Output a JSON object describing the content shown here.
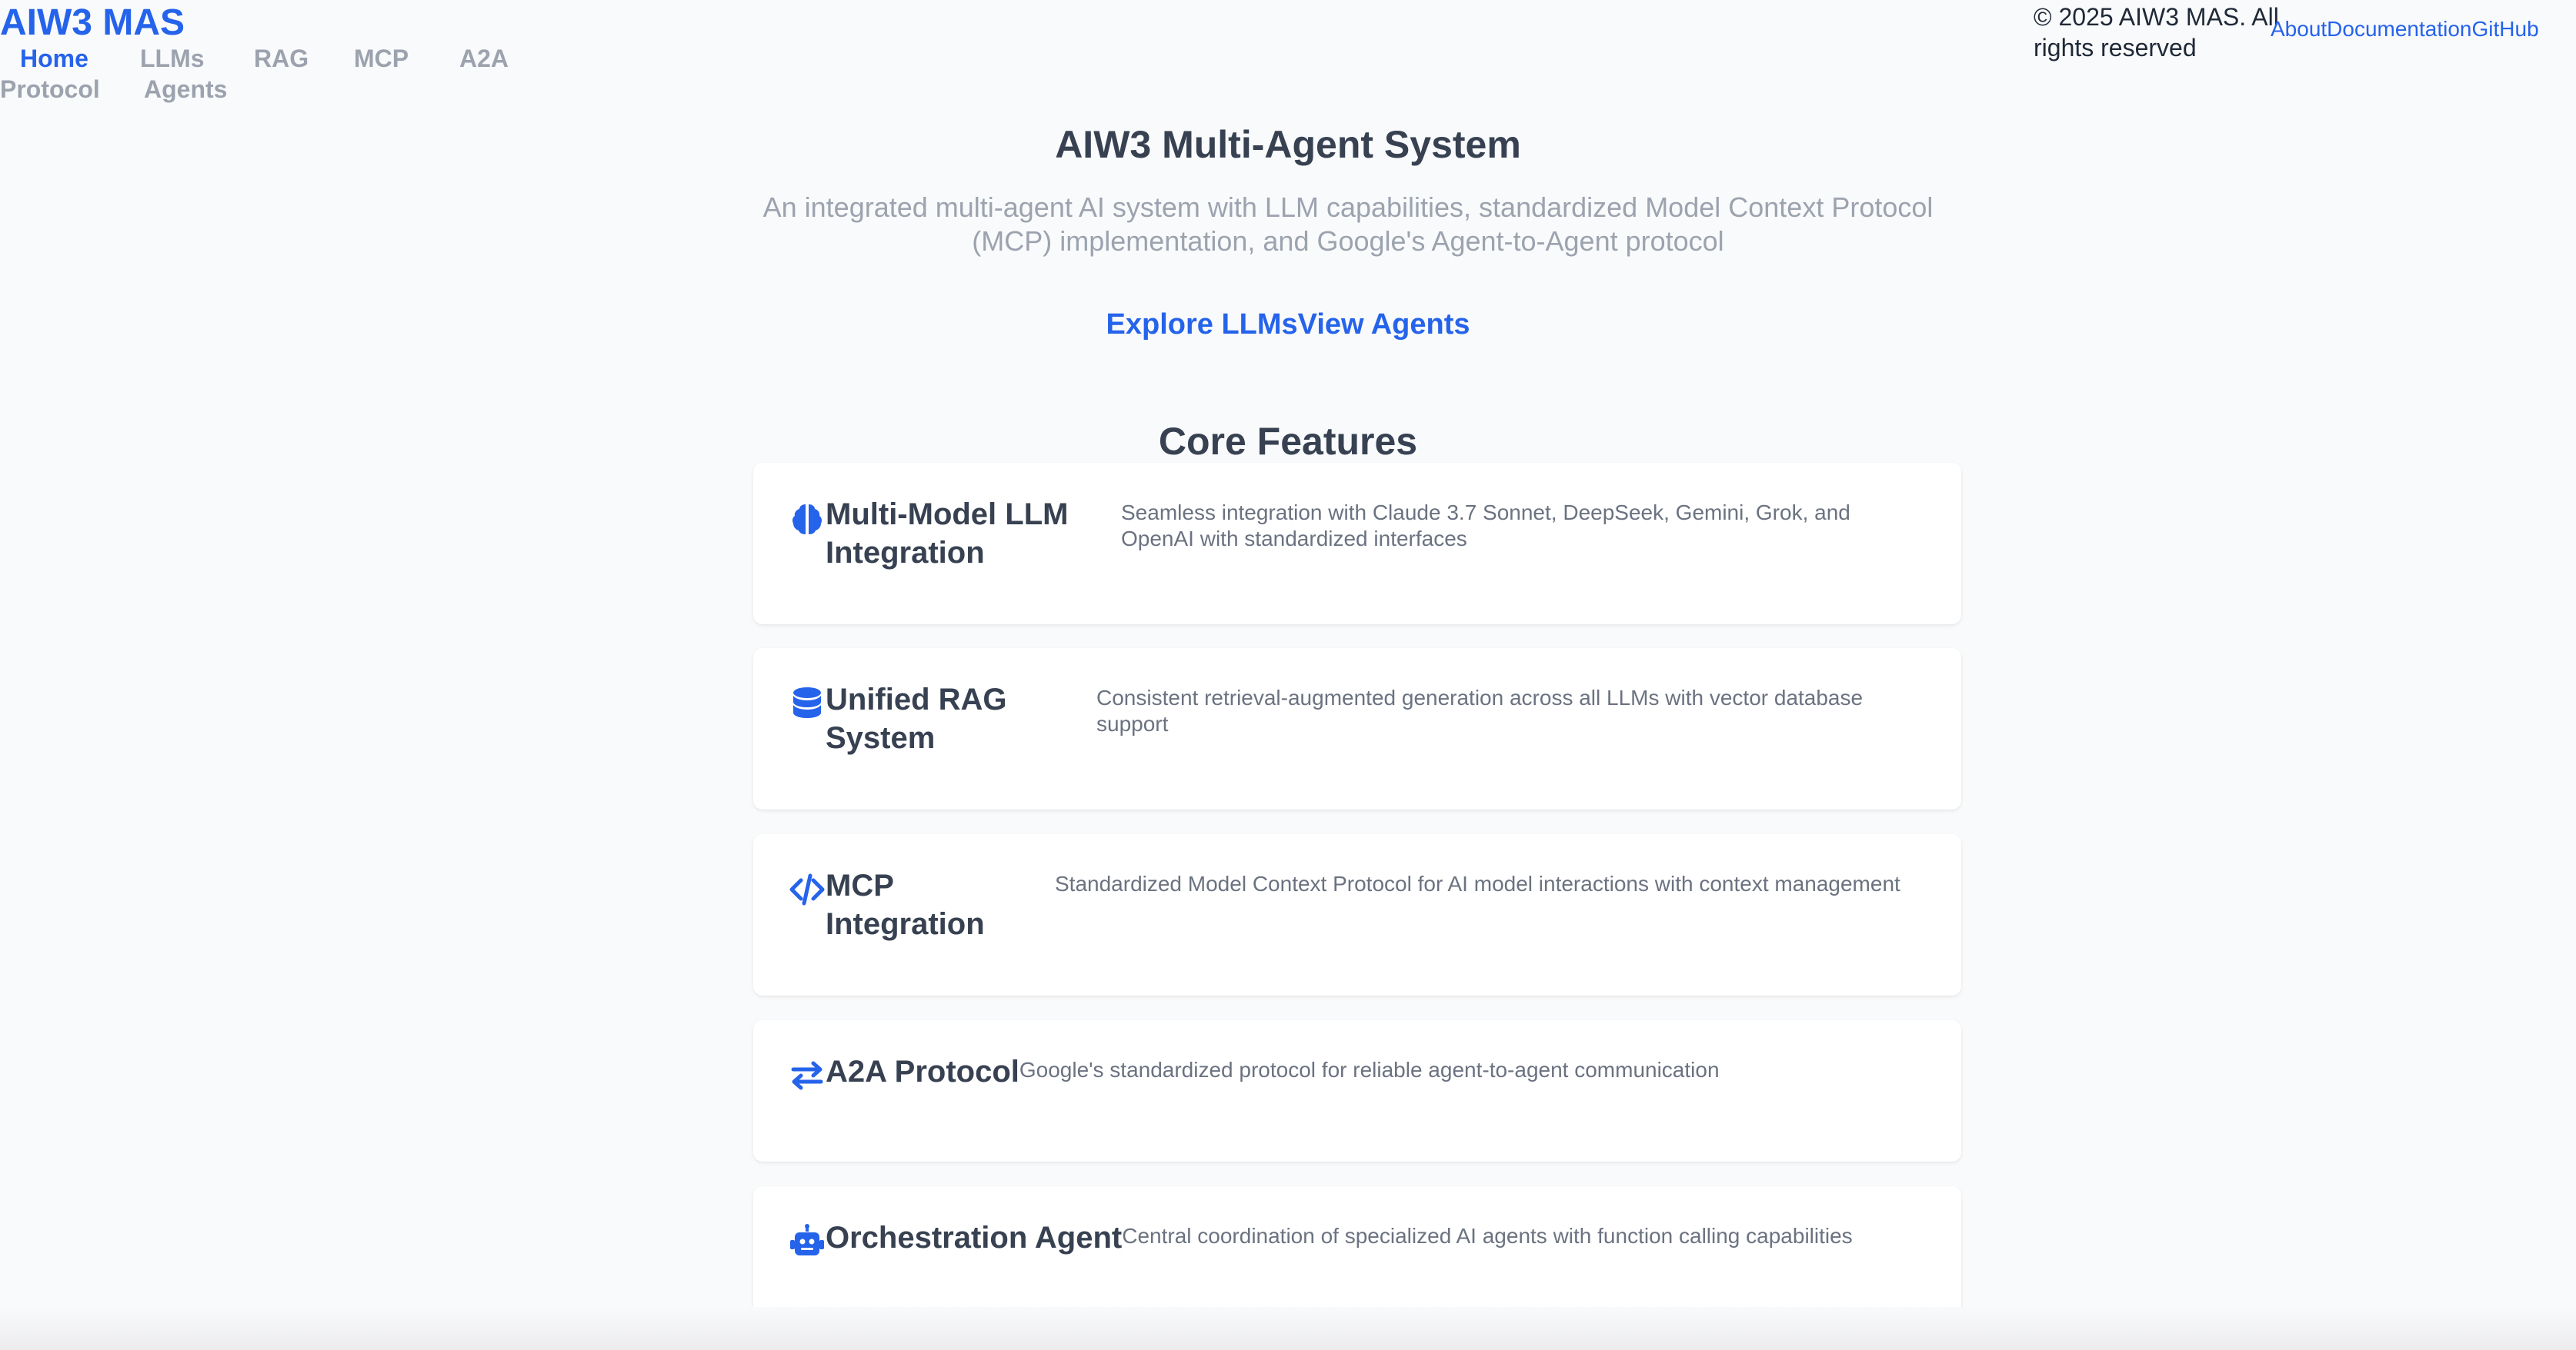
{
  "brand": "AIW3 MAS",
  "nav": {
    "home": "Home",
    "llms": "LLMs",
    "rag": "RAG",
    "mcp": "MCP",
    "a2a_l1": "A2A",
    "a2a_l2": "Protocol",
    "agents": "Agents"
  },
  "footer": {
    "copyright": "© 2025 AIW3 MAS. All rights reserved",
    "about": "About",
    "documentation": "Documentation",
    "github": "GitHub"
  },
  "hero": {
    "title": "AIW3 Multi-Agent System",
    "subtitle": "An integrated multi-agent AI system with LLM capabilities, standardized Model Context Protocol (MCP) implementation, and Google's Agent-to-Agent protocol",
    "explore_llms": "Explore LLMs",
    "view_agents": "View Agents"
  },
  "features": {
    "heading": "Core Features",
    "items": [
      {
        "icon": "brain-icon",
        "title": "Multi-Model LLM Integration",
        "description": "Seamless integration with Claude 3.7 Sonnet, DeepSeek, Gemini, Grok, and OpenAI with standardized interfaces"
      },
      {
        "icon": "database-icon",
        "title": "Unified RAG System",
        "description": "Consistent retrieval-augmented generation across all LLMs with vector database support"
      },
      {
        "icon": "code-icon",
        "title": "MCP Integration",
        "description": "Standardized Model Context Protocol for AI model interactions with context management"
      },
      {
        "icon": "exchange-arrows-icon",
        "title": "A2A Protocol",
        "description": "Google's standardized protocol for reliable agent-to-agent communication"
      },
      {
        "icon": "robot-icon",
        "title": "Orchestration Agent",
        "description": "Central coordination of specialized AI agents with function calling capabilities"
      }
    ]
  },
  "colors": {
    "accent": "#2563eb",
    "background": "#f9fafb",
    "card": "#ffffff",
    "muted_text": "#9ca3af"
  }
}
